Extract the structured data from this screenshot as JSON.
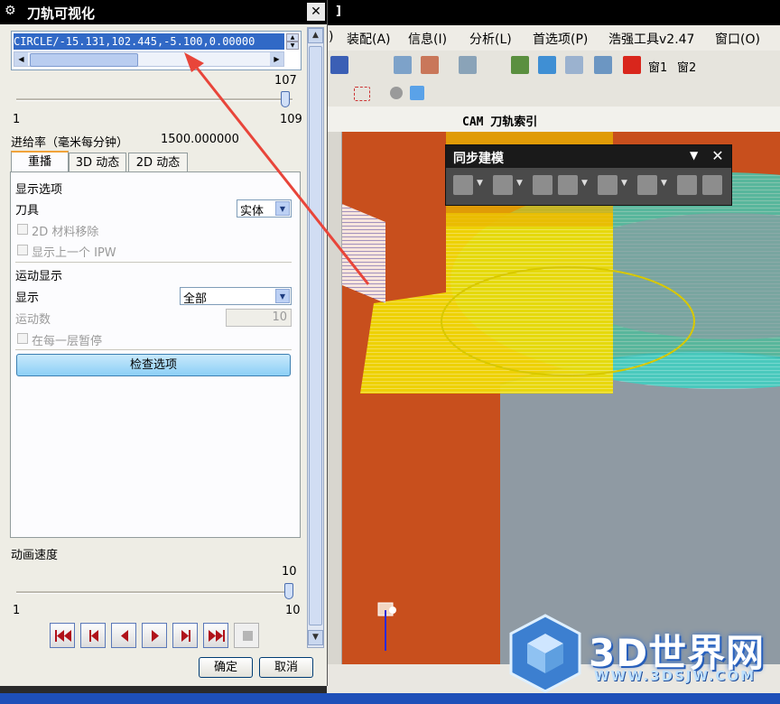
{
  "dialog": {
    "title": "刀轨可视化",
    "cmd_line": "CIRCLE/-15.131,102.445,-5.100,0.00000",
    "slider1": {
      "max_label": "107",
      "min_label": "1",
      "end_label": "109"
    },
    "feedrate_label": "进给率（毫米每分钟）",
    "feedrate_value": "1500.000000",
    "tabs": [
      "重播",
      "3D 动态",
      "2D 动态"
    ],
    "display_options": {
      "header": "显示选项",
      "tool_label": "刀具",
      "tool_value": "实体",
      "material_removal_label": "2D 材料移除",
      "prev_ipw_label": "显示上一个 IPW"
    },
    "motion_display": {
      "header": "运动显示",
      "display_label": "显示",
      "display_value": "全部",
      "count_label": "运动数",
      "count_value": "10",
      "pause_label": "在每一层暂停"
    },
    "check_button": "检查选项",
    "anim_speed": {
      "label": "动画速度",
      "value_label": "10",
      "min_label": "1",
      "max_label": "10"
    },
    "ok_button": "确定",
    "cancel_button": "取消"
  },
  "app": {
    "title_fragment": "]",
    "menu": [
      "装配(A)",
      "信息(I)",
      "分析(L)",
      "首选项(P)",
      "浩强工具v2.47",
      "窗口(O)"
    ],
    "toolbar_labels": [
      "窗1",
      "窗2"
    ],
    "cam_bar_title": "CAM 刀轨索引",
    "sync_title": "同步建模"
  },
  "watermark": {
    "text": "3D世界网",
    "url": "WWW.3DSJW.COM"
  },
  "colors": {
    "toolpath_yellow": "#f5e600",
    "toolpath_cyan": "#35e6d6",
    "stock_orange": "#c84f1d",
    "part_grey": "#8f9aa3",
    "arrow_red": "#e8453a"
  }
}
